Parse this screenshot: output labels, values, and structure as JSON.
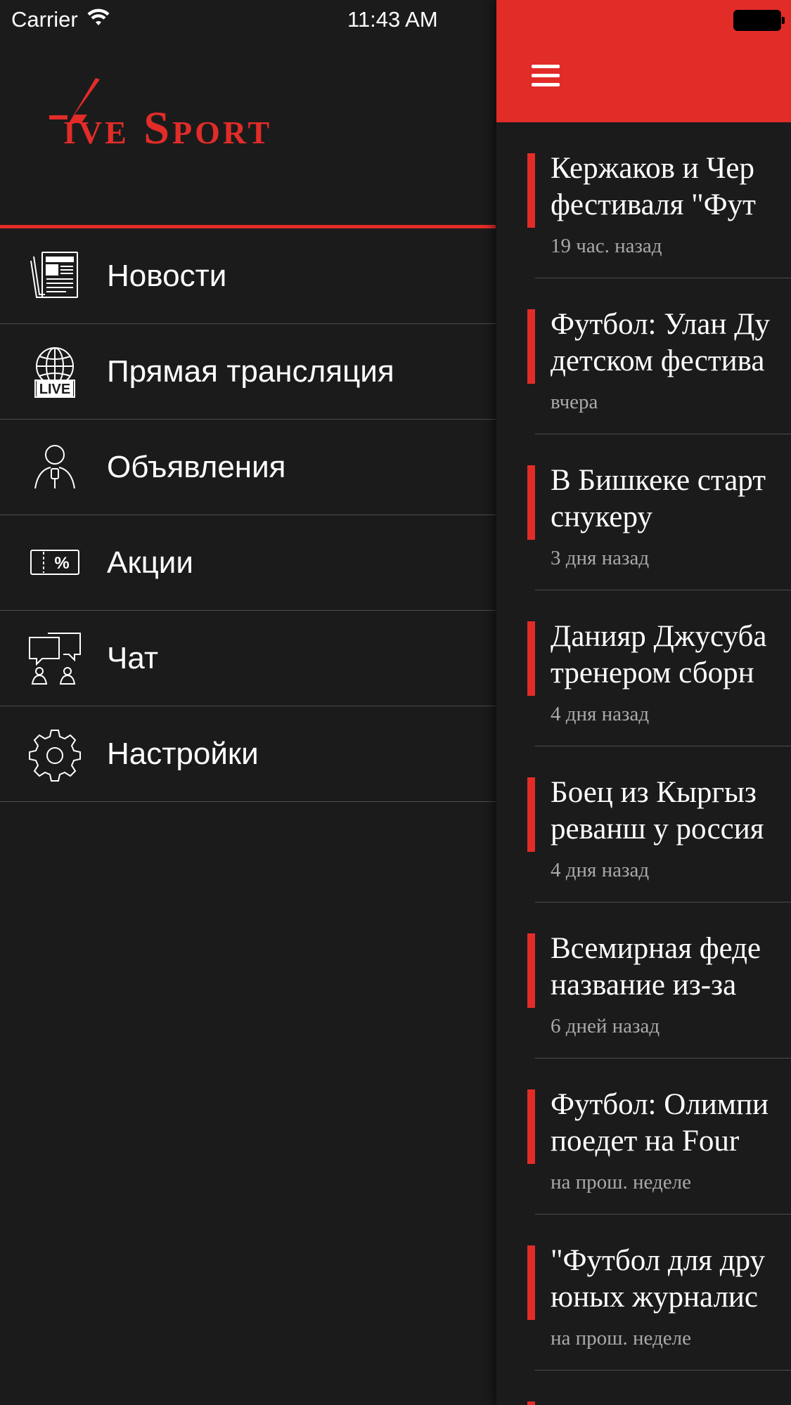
{
  "status_bar": {
    "carrier": "Carrier",
    "time": "11:43 AM",
    "wifi_icon": "wifi-icon",
    "battery_icon": "battery-icon"
  },
  "brand": {
    "logo_text": "Live Sport",
    "accent_color": "#e22c28",
    "background_color": "#1b1b1c"
  },
  "menu": {
    "items": [
      {
        "label": "Новости",
        "icon": "newspaper-icon"
      },
      {
        "label": "Прямая трансляция",
        "icon": "live-globe-icon"
      },
      {
        "label": "Объявления",
        "icon": "person-announcement-icon"
      },
      {
        "label": "Акции",
        "icon": "discount-ticket-icon"
      },
      {
        "label": "Чат",
        "icon": "chat-icon"
      },
      {
        "label": "Настройки",
        "icon": "gear-icon"
      }
    ]
  },
  "news": {
    "menu_icon": "hamburger-icon",
    "items": [
      {
        "title_line1": "Кержаков и Чер",
        "title_line2": "фестиваля \"Фут",
        "time": "19 час. назад"
      },
      {
        "title_line1": "Футбол: Улан Ду",
        "title_line2": "детском фестива",
        "time": "вчера"
      },
      {
        "title_line1": "В Бишкеке старт",
        "title_line2": "снукеру",
        "time": "3 дня назад"
      },
      {
        "title_line1": "Данияр Джусуба",
        "title_line2": "тренером сборн",
        "time": "4 дня назад"
      },
      {
        "title_line1": "Боец из Кыргыз",
        "title_line2": "реванш у россия",
        "time": "4 дня назад"
      },
      {
        "title_line1": "Всемирная феде",
        "title_line2": "название из-за ",
        "time": "6 дней назад"
      },
      {
        "title_line1": "Футбол: Олимпи",
        "title_line2": "поедет на Four ",
        "time": "на прош. неделе"
      },
      {
        "title_line1": "\"Футбол для дру",
        "title_line2": "юных журналис",
        "time": "на прош. неделе"
      }
    ]
  }
}
